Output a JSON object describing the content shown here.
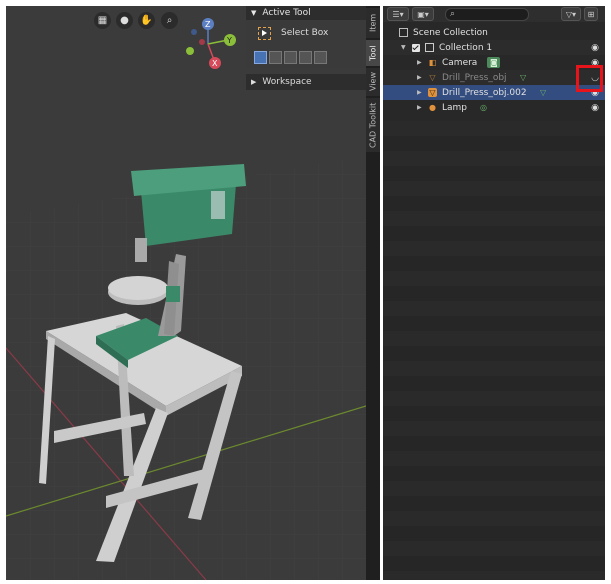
{
  "viewport": {
    "nav_icons": [
      "grid-icon",
      "camera-icon",
      "hand-icon",
      "zoom-icon"
    ],
    "gizmo": {
      "z": "Z",
      "y": "Y",
      "x": "X"
    }
  },
  "npanel": {
    "active_tool_header": "Active Tool",
    "select_box_label": "Select Box",
    "workspace_header": "Workspace"
  },
  "tabs": [
    "Item",
    "Tool",
    "View",
    "CAD Toolkit"
  ],
  "outliner": {
    "search_placeholder": "",
    "scene_collection": "Scene Collection",
    "rows": [
      {
        "label": "Collection 1"
      },
      {
        "label": "Camera"
      },
      {
        "label": "Drill_Press_obj"
      },
      {
        "label": "Drill_Press_obj.002"
      },
      {
        "label": "Lamp"
      }
    ]
  },
  "colors": {
    "accent": "#334d80",
    "highlight": "#e8141c",
    "model_green": "#3a8a6a"
  }
}
